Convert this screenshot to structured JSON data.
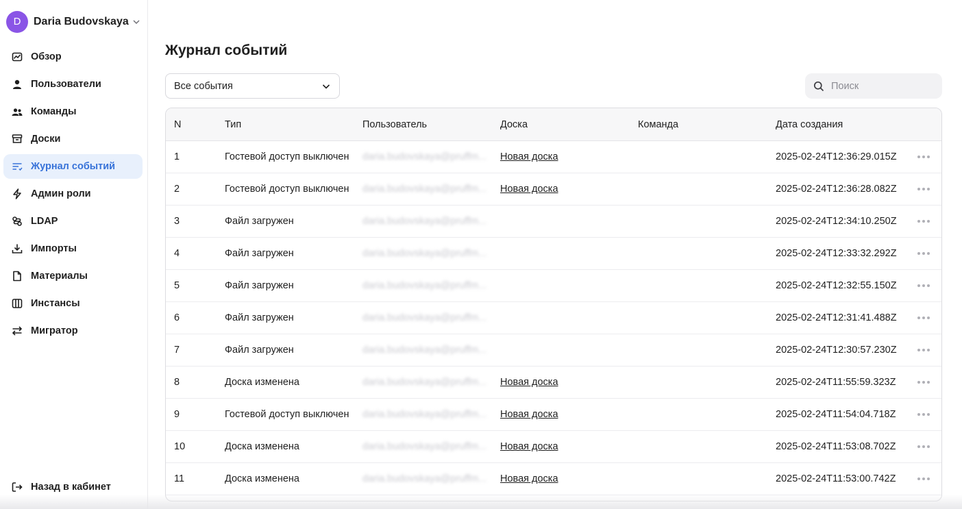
{
  "user": {
    "initial": "D",
    "name": "Daria Budovskaya",
    "avatar_color": "#8a55e6"
  },
  "sidebar": {
    "items": [
      {
        "label": "Обзор",
        "icon": "chart-icon"
      },
      {
        "label": "Пользователи",
        "icon": "user-icon"
      },
      {
        "label": "Команды",
        "icon": "users-icon"
      },
      {
        "label": "Доски",
        "icon": "box-icon"
      },
      {
        "label": "Журнал событий",
        "icon": "log-list-icon",
        "active": true
      },
      {
        "label": "Админ роли",
        "icon": "lightning-icon"
      },
      {
        "label": "LDAP",
        "icon": "ldap-icon"
      },
      {
        "label": "Импорты",
        "icon": "import-icon"
      },
      {
        "label": "Материалы",
        "icon": "document-icon"
      },
      {
        "label": "Инстансы",
        "icon": "columns-icon"
      },
      {
        "label": "Мигратор",
        "icon": "arrows-swap-icon"
      }
    ],
    "back_label": "Назад в кабинет"
  },
  "main": {
    "title": "Журнал событий",
    "filter": {
      "value": "Все события"
    },
    "search": {
      "placeholder": "Поиск",
      "value": ""
    }
  },
  "table": {
    "columns": [
      "N",
      "Тип",
      "Пользователь",
      "Доска",
      "Команда",
      "Дата создания"
    ],
    "rows": [
      {
        "n": "1",
        "type": "Гостевой доступ выключен",
        "user": "daria.budovskaya@pruffm...",
        "board": "Новая доска",
        "team": "",
        "date": "2025-02-24T12:36:29.015Z"
      },
      {
        "n": "2",
        "type": "Гостевой доступ выключен",
        "user": "daria.budovskaya@pruffm...",
        "board": "Новая доска",
        "team": "",
        "date": "2025-02-24T12:36:28.082Z"
      },
      {
        "n": "3",
        "type": "Файл загружен",
        "user": "daria.budovskaya@pruffm...",
        "board": "",
        "team": "",
        "date": "2025-02-24T12:34:10.250Z"
      },
      {
        "n": "4",
        "type": "Файл загружен",
        "user": "daria.budovskaya@pruffm...",
        "board": "",
        "team": "",
        "date": "2025-02-24T12:33:32.292Z"
      },
      {
        "n": "5",
        "type": "Файл загружен",
        "user": "daria.budovskaya@pruffm...",
        "board": "",
        "team": "",
        "date": "2025-02-24T12:32:55.150Z"
      },
      {
        "n": "6",
        "type": "Файл загружен",
        "user": "daria.budovskaya@pruffm...",
        "board": "",
        "team": "",
        "date": "2025-02-24T12:31:41.488Z"
      },
      {
        "n": "7",
        "type": "Файл загружен",
        "user": "daria.budovskaya@pruffm...",
        "board": "",
        "team": "",
        "date": "2025-02-24T12:30:57.230Z"
      },
      {
        "n": "8",
        "type": "Доска изменена",
        "user": "daria.budovskaya@pruffm...",
        "board": "Новая доска",
        "team": "",
        "date": "2025-02-24T11:55:59.323Z"
      },
      {
        "n": "9",
        "type": "Гостевой доступ выключен",
        "user": "daria.budovskaya@pruffm...",
        "board": "Новая доска",
        "team": "",
        "date": "2025-02-24T11:54:04.718Z"
      },
      {
        "n": "10",
        "type": "Доска изменена",
        "user": "daria.budovskaya@pruffm...",
        "board": "Новая доска",
        "team": "",
        "date": "2025-02-24T11:53:08.702Z"
      },
      {
        "n": "11",
        "type": "Доска изменена",
        "user": "daria.budovskaya@pruffm...",
        "board": "Новая доска",
        "team": "",
        "date": "2025-02-24T11:53:00.742Z"
      }
    ]
  },
  "colors": {
    "accent": "#3873d9",
    "active_bg": "#e8f0fc"
  }
}
